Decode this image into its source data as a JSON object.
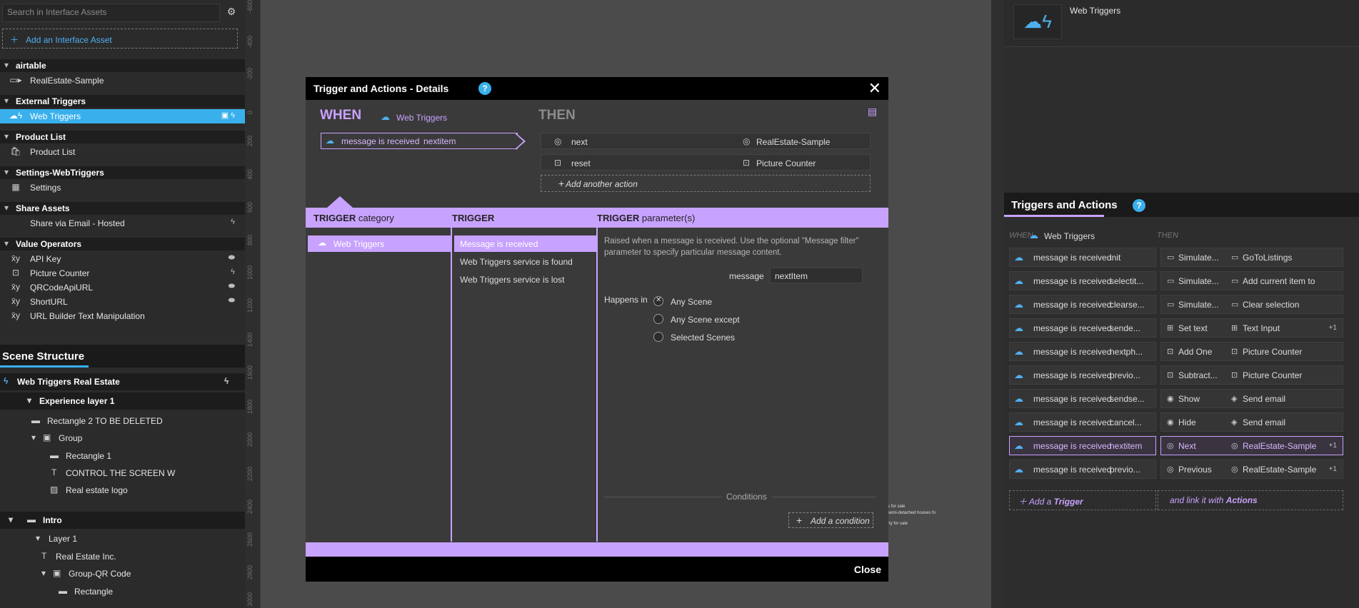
{
  "left_panel": {
    "search_placeholder": "Search in Interface Assets",
    "add_asset_label": "Add an Interface Asset",
    "groups": [
      {
        "title": "airtable",
        "items": [
          {
            "label": "RealEstate-Sample",
            "icon": "airtable-icon"
          }
        ]
      },
      {
        "title": "External Triggers",
        "items": [
          {
            "label": "Web Triggers",
            "icon": "web-trigger-icon",
            "selected": true
          }
        ]
      },
      {
        "title": "Product List",
        "items": [
          {
            "label": "Product List",
            "icon": "shopping-bag-icon"
          }
        ]
      },
      {
        "title": "Settings-WebTriggers",
        "items": [
          {
            "label": "Settings",
            "icon": "grid-icon"
          }
        ]
      },
      {
        "title": "Share Assets",
        "items": [
          {
            "label": "Share via Email - Hosted",
            "icon": "share-icon"
          }
        ]
      },
      {
        "title": "Value Operators",
        "items": [
          {
            "label": "API Key",
            "icon": "value-operator-icon"
          },
          {
            "label": "Picture Counter",
            "icon": "counter-icon"
          },
          {
            "label": "QRCodeApiURL",
            "icon": "value-operator-icon"
          },
          {
            "label": "ShortURL",
            "icon": "value-operator-icon"
          },
          {
            "label": "URL Builder Text Manipulation",
            "icon": "value-operator-icon"
          }
        ]
      }
    ],
    "ruler_ticks": [
      "-600",
      "-400",
      "-200",
      "0",
      "200",
      "400",
      "600",
      "800",
      "1000",
      "1200",
      "1400",
      "1600",
      "1800",
      "2000",
      "2200",
      "2400",
      "2600",
      "2800",
      "3000"
    ]
  },
  "scene_structure": {
    "title": "Scene Structure",
    "rows": [
      "Web Triggers Real Estate",
      "Experience layer 1",
      "Rectangle 2 TO BE DELETED",
      "Group",
      "Rectangle 1",
      "CONTROL THE SCREEN W",
      "Real estate logo",
      "Intro",
      "Layer 1",
      "Real Estate Inc.",
      "Group-QR Code",
      "Rectangle"
    ]
  },
  "modal": {
    "title": "Trigger and Actions - Details",
    "help": "?",
    "close_x": "✕",
    "when_label": "WHEN",
    "when_asset": "Web Triggers",
    "then_label": "THEN",
    "trigger_text": "message is received",
    "trigger_value": "nextitem",
    "actions": [
      {
        "action": "next",
        "target": "RealEstate-Sample"
      },
      {
        "action": "reset",
        "target": "Picture Counter"
      }
    ],
    "add_action_label": "Add another action",
    "col_trigger": "TRIGGER",
    "col_category_suffix": "category",
    "col_params_suffix": "parameter(s)",
    "category_selected": "Web Triggers",
    "trigger_options": [
      "Message is received",
      "Web Triggers service is found",
      "Web Triggers service is lost"
    ],
    "description": "Raised when a message is received. Use the optional \"Message filter\" parameter to specify particular message content.",
    "message_label": "message",
    "message_value": "nextItem",
    "happens_in_label": "Happens in",
    "scene_options": [
      "Any Scene",
      "Any Scene except",
      "Selected Scenes"
    ],
    "conditions_label": "Conditions",
    "add_condition_label": "Add a condition",
    "footer_close": "Close"
  },
  "right_panel": {
    "asset_title": "Web Triggers",
    "section_title": "Triggers and Actions",
    "help": "?",
    "when_label": "WHEN",
    "when_asset": "Web Triggers",
    "then_label": "THEN",
    "rows": [
      {
        "trigger": "message is received",
        "value": "init",
        "a1": "Simulate...",
        "a2": "GoToListings",
        "plus": ""
      },
      {
        "trigger": "message is received",
        "value": "selectit...",
        "a1": "Simulate...",
        "a2": "Add current item to",
        "plus": ""
      },
      {
        "trigger": "message is received",
        "value": "clearse...",
        "a1": "Simulate...",
        "a2": "Clear selection",
        "plus": ""
      },
      {
        "trigger": "message is received",
        "value": "sende...",
        "a1": "Set text",
        "a2": "Text Input",
        "plus": "+1"
      },
      {
        "trigger": "message is received",
        "value": "nextph...",
        "a1": "Add One",
        "a2": "Picture Counter",
        "plus": ""
      },
      {
        "trigger": "message is received",
        "value": "previo...",
        "a1": "Subtract...",
        "a2": "Picture Counter",
        "plus": ""
      },
      {
        "trigger": "message is received",
        "value": "sendse...",
        "a1": "Show",
        "a2": "Send email",
        "plus": ""
      },
      {
        "trigger": "message is received",
        "value": "cancel...",
        "a1": "Hide",
        "a2": "Send email",
        "plus": ""
      },
      {
        "trigger": "message is received",
        "value": "nextitem",
        "a1": "Next",
        "a2": "RealEstate-Sample",
        "plus": "+1"
      },
      {
        "trigger": "message is received",
        "value": "previo...",
        "a1": "Previous",
        "a2": "RealEstate-Sample",
        "plus": "+1"
      }
    ],
    "add_trigger_prefix": "Add a",
    "add_trigger_bold": "Trigger",
    "link_prefix": "and link it with",
    "link_bold": "Actions"
  },
  "canvas_artifact": [
    "s for sale",
    "semi-detached houses fo",
    "rty for sale"
  ]
}
